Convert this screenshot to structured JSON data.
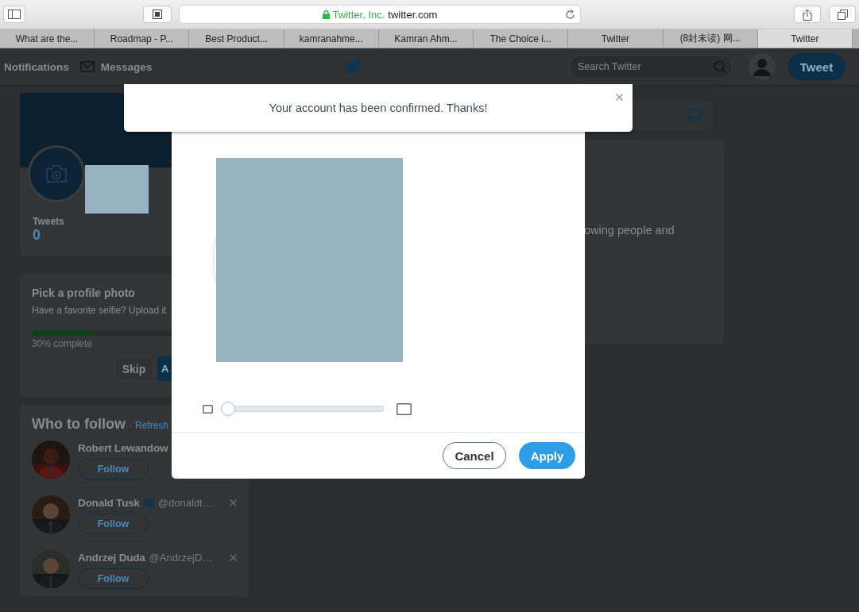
{
  "browser": {
    "company": "Twitter, Inc.",
    "domain": "twitter.com"
  },
  "tabs": [
    {
      "label": "What are the...",
      "selected": false
    },
    {
      "label": "Roadmap - P...",
      "selected": false
    },
    {
      "label": "Best Product...",
      "selected": false
    },
    {
      "label": "kamranahme...",
      "selected": false
    },
    {
      "label": "Kamran Ahm...",
      "selected": false
    },
    {
      "label": "The Choice i...",
      "selected": false
    },
    {
      "label": "Twitter",
      "selected": false
    },
    {
      "label": "(8封未读) 网...",
      "selected": false
    },
    {
      "label": "Twitter",
      "selected": true
    }
  ],
  "nav": {
    "items": [
      {
        "label": "Notifications",
        "kind": "plain"
      },
      {
        "label": "Messages",
        "kind": "mail"
      }
    ],
    "search": {
      "placeholder": "Search Twitter"
    },
    "tweet_button": "Tweet"
  },
  "profile": {
    "stat_label": "Tweets",
    "stat_value": "0"
  },
  "onboarding": {
    "title": "Pick a profile photo",
    "text": "Have a favorite selfie? Upload it",
    "level": 0.3,
    "progress_text": "30% complete",
    "skip": "Skip",
    "next": "A"
  },
  "who_to_follow": {
    "title": "Who to follow",
    "separator": "·",
    "refresh": "Refresh",
    "people": [
      {
        "name": "Robert Lewandow",
        "verified": false,
        "dismissible": false,
        "follow": "Follow"
      },
      {
        "name": "Donald Tusk",
        "handle": "@donaldt…",
        "verified": true,
        "dismissible": true,
        "follow": "Follow"
      },
      {
        "name": "Andrzej Duda",
        "handle": "@AndrzejD…",
        "verified": false,
        "dismissible": true,
        "follow": "Follow"
      }
    ]
  },
  "stream": {
    "text": "owing people and"
  },
  "banner": {
    "message": "Your account has been confirmed. Thanks!"
  },
  "crop_dialog": {
    "zoom": {
      "level": 0
    },
    "buttons": [
      {
        "label": "Cancel",
        "kind": "secondary"
      },
      {
        "label": "Apply",
        "kind": "primary"
      }
    ]
  }
}
